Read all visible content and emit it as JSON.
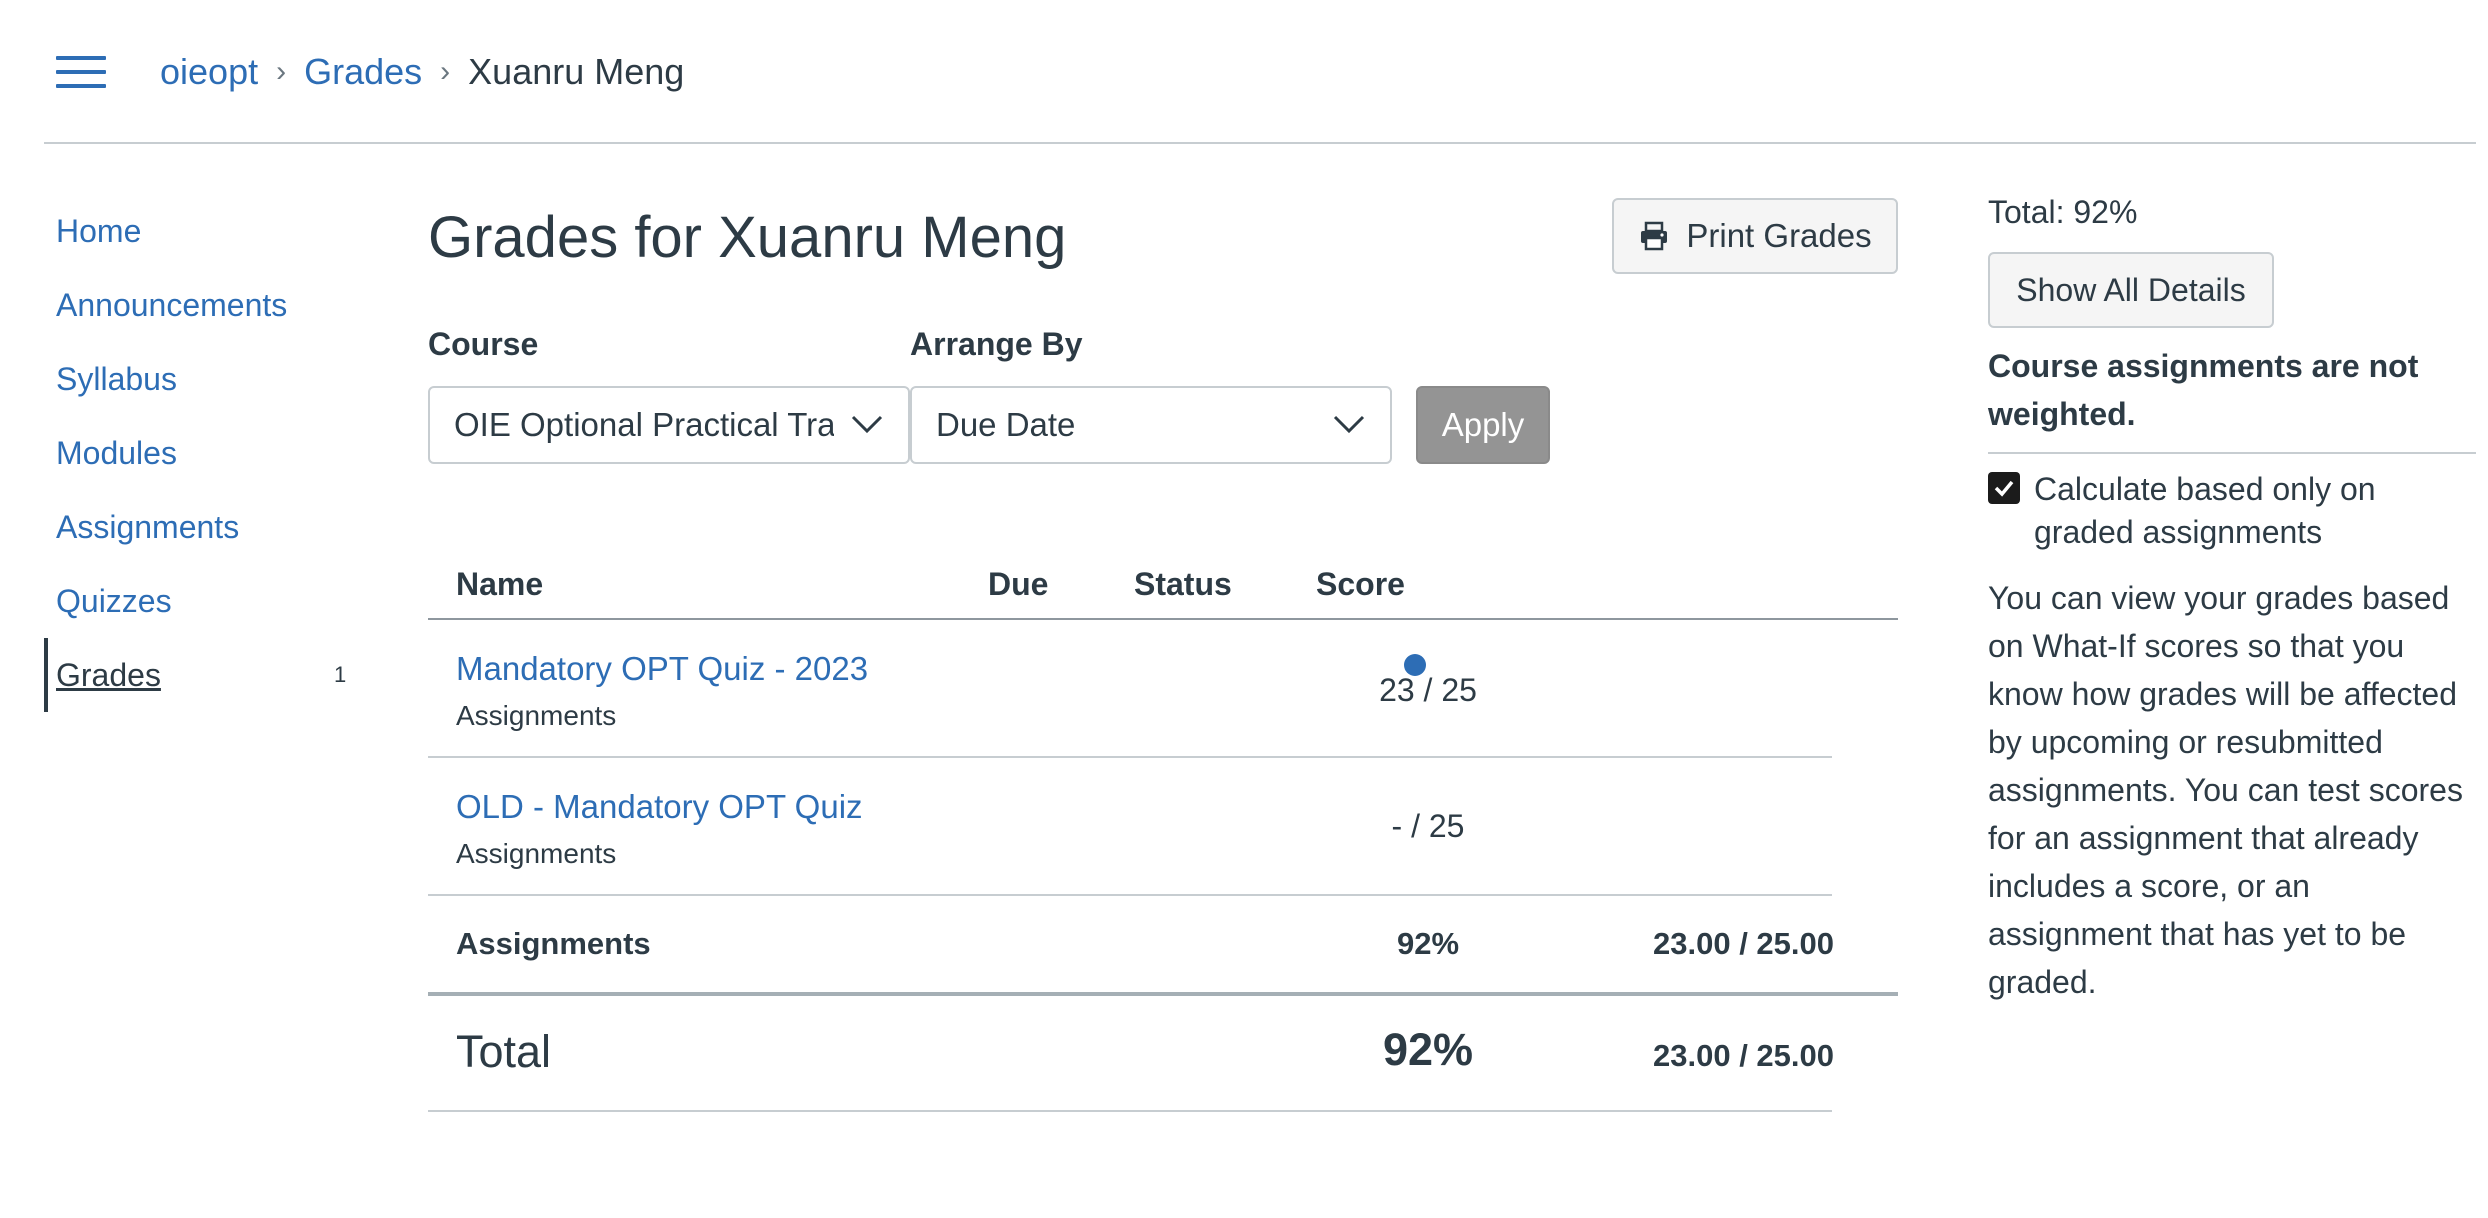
{
  "header": {
    "menu_icon": "hamburger-menu-icon",
    "breadcrumb": {
      "course": "oieopt",
      "section": "Grades",
      "current": "Xuanru Meng",
      "separator": "›"
    }
  },
  "nav": {
    "items": [
      {
        "label": "Home"
      },
      {
        "label": "Announcements"
      },
      {
        "label": "Syllabus"
      },
      {
        "label": "Modules"
      },
      {
        "label": "Assignments"
      },
      {
        "label": "Quizzes"
      },
      {
        "label": "Grades",
        "badge": "1",
        "active": true
      }
    ]
  },
  "main": {
    "title": "Grades for Xuanru Meng",
    "print_label": "Print Grades",
    "print_icon": "printer-icon",
    "course_label": "Course",
    "course_value": "OIE Optional Practical Training",
    "arrange_label": "Arrange By",
    "arrange_value": "Due Date",
    "apply_label": "Apply"
  },
  "table": {
    "headers": {
      "name": "Name",
      "due": "Due",
      "status": "Status",
      "score": "Score"
    },
    "rows": [
      {
        "name": "Mandatory OPT Quiz - 2023",
        "group": "Assignments",
        "score": "23 / 25",
        "unread": true
      },
      {
        "name": "OLD - Mandatory OPT Quiz",
        "group": "Assignments",
        "score": "- / 25",
        "unread": false
      }
    ],
    "group_total": {
      "name": "Assignments",
      "percent": "92%",
      "fraction": "23.00 / 25.00"
    },
    "total": {
      "label": "Total",
      "percent": "92%",
      "fraction": "23.00 / 25.00"
    }
  },
  "sidebar": {
    "total": "Total: 92%",
    "show_details": "Show All Details",
    "weight_note": "Course assignments are not weighted.",
    "calc_checkbox_label": "Calculate based only on graded assignments",
    "calc_checked": true,
    "whatif_text": "You can view your grades based on What-If scores so that you know how grades will be affected by upcoming or resubmitted assignments. You can test scores for an assignment that already includes a score, or an assignment that has yet to be graded."
  },
  "colors": {
    "link": "#2d6db5",
    "text": "#2d3b45",
    "border": "#c7cdd1",
    "apply_disabled": "#949494"
  }
}
